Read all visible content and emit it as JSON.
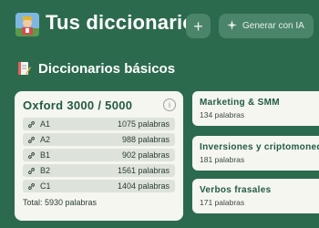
{
  "header": {
    "title": "Tus diccionarios",
    "add_label": "+",
    "ai_label": "Generar con IA",
    "app_icon": "user-avatar-icon"
  },
  "section": {
    "icon": "notebook-pencil-icon",
    "title": "Diccionarios básicos"
  },
  "main_card": {
    "title": "Oxford 3000 / 5000",
    "info_icon_label": "i",
    "levels": [
      {
        "level": "A1",
        "count": "1075 palabras"
      },
      {
        "level": "A2",
        "count": "988 palabras"
      },
      {
        "level": "B1",
        "count": "902 palabras"
      },
      {
        "level": "B2",
        "count": "1561 palabras"
      },
      {
        "level": "C1",
        "count": "1404 palabras"
      }
    ],
    "total": "Total: 5930 palabras"
  },
  "side_cards": [
    {
      "title": "Marketing & SMM",
      "count": "134 palabras"
    },
    {
      "title": "Inversiones y criptomonedas",
      "count": "181 palabras"
    },
    {
      "title": "Verbos frasales",
      "count": "171 palabras"
    }
  ],
  "colors": {
    "background": "#2c6a4e",
    "button": "#4a8469",
    "card": "#f4f6ef",
    "card_title": "#245a44",
    "level_row": "#dde3da"
  }
}
